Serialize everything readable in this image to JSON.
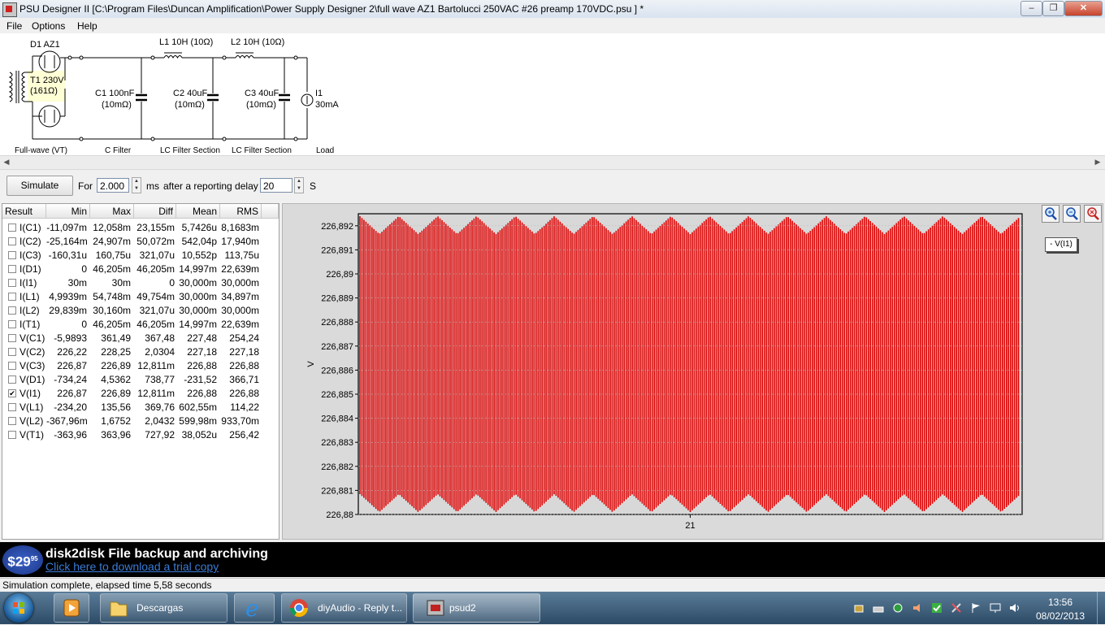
{
  "window": {
    "title": "PSU Designer II  [C:\\Program Files\\Duncan Amplification\\Power Supply Designer 2\\full wave AZ1 Bartolucci 250VAC #26 preamp 170VDC.psu ] *",
    "min": "–",
    "max": "❐",
    "close": "✕"
  },
  "menu": [
    "File",
    "Options",
    "Help"
  ],
  "schematic": {
    "d1": "D1  AZ1",
    "t1_line1": "T1 230V",
    "t1_line2": "(161Ω)",
    "l1": "L1 10H (10Ω)",
    "l2": "L2 10H (10Ω)",
    "c1_line1": "C1 100nF",
    "c1_line2": "(10mΩ)",
    "c2_line1": "C2 40uF",
    "c2_line2": "(10mΩ)",
    "c3_line1": "C3 40uF",
    "c3_line2": "(10mΩ)",
    "i1_line1": "I1",
    "i1_line2": "30mA",
    "sections": [
      "Full-wave (VT)",
      "C Filter",
      "LC Filter Section",
      "LC Filter Section",
      "Load"
    ]
  },
  "sim": {
    "button": "Simulate",
    "for_label": "For",
    "duration": "2.000",
    "ms_label": "ms",
    "delay_label": "after a reporting delay of",
    "delay": "20",
    "s_label": "S"
  },
  "results": {
    "headers": [
      "Result",
      "Min",
      "Max",
      "Diff",
      "Mean",
      "RMS"
    ],
    "rows": [
      {
        "name": "I(C1)",
        "min": "-11,097m",
        "max": "12,058m",
        "diff": "23,155m",
        "mean": "5,7426u",
        "rms": "8,1683m",
        "checked": false
      },
      {
        "name": "I(C2)",
        "min": "-25,164m",
        "max": "24,907m",
        "diff": "50,072m",
        "mean": "542,04p",
        "rms": "17,940m",
        "checked": false
      },
      {
        "name": "I(C3)",
        "min": "-160,31u",
        "max": "160,75u",
        "diff": "321,07u",
        "mean": "10,552p",
        "rms": "113,75u",
        "checked": false
      },
      {
        "name": "I(D1)",
        "min": "0",
        "max": "46,205m",
        "diff": "46,205m",
        "mean": "14,997m",
        "rms": "22,639m",
        "checked": false
      },
      {
        "name": "I(I1)",
        "min": "30m",
        "max": "30m",
        "diff": "0",
        "mean": "30,000m",
        "rms": "30,000m",
        "checked": false
      },
      {
        "name": "I(L1)",
        "min": "4,9939m",
        "max": "54,748m",
        "diff": "49,754m",
        "mean": "30,000m",
        "rms": "34,897m",
        "checked": false
      },
      {
        "name": "I(L2)",
        "min": "29,839m",
        "max": "30,160m",
        "diff": "321,07u",
        "mean": "30,000m",
        "rms": "30,000m",
        "checked": false
      },
      {
        "name": "I(T1)",
        "min": "0",
        "max": "46,205m",
        "diff": "46,205m",
        "mean": "14,997m",
        "rms": "22,639m",
        "checked": false
      },
      {
        "name": "V(C1)",
        "min": "-5,9893",
        "max": "361,49",
        "diff": "367,48",
        "mean": "227,48",
        "rms": "254,24",
        "checked": false
      },
      {
        "name": "V(C2)",
        "min": "226,22",
        "max": "228,25",
        "diff": "2,0304",
        "mean": "227,18",
        "rms": "227,18",
        "checked": false
      },
      {
        "name": "V(C3)",
        "min": "226,87",
        "max": "226,89",
        "diff": "12,811m",
        "mean": "226,88",
        "rms": "226,88",
        "checked": false
      },
      {
        "name": "V(D1)",
        "min": "-734,24",
        "max": "4,5362",
        "diff": "738,77",
        "mean": "-231,52",
        "rms": "366,71",
        "checked": false
      },
      {
        "name": "V(I1)",
        "min": "226,87",
        "max": "226,89",
        "diff": "12,811m",
        "mean": "226,88",
        "rms": "226,88",
        "checked": true
      },
      {
        "name": "V(L1)",
        "min": "-234,20",
        "max": "135,56",
        "diff": "369,76",
        "mean": "602,55m",
        "rms": "114,22",
        "checked": false
      },
      {
        "name": "V(L2)",
        "min": "-367,96m",
        "max": "1,6752",
        "diff": "2,0432",
        "mean": "599,98m",
        "rms": "933,70m",
        "checked": false
      },
      {
        "name": "V(T1)",
        "min": "-363,96",
        "max": "363,96",
        "diff": "727,92",
        "mean": "38,052u",
        "rms": "256,42",
        "checked": false
      }
    ]
  },
  "chart_data": {
    "type": "line",
    "title": "",
    "ylabel": "V",
    "xlabel": "",
    "x_ticks": [
      "21"
    ],
    "y_ticks": [
      "226,892",
      "226,891",
      "226,89",
      "226,889",
      "226,888",
      "226,887",
      "226,886",
      "226,885",
      "226,884",
      "226,883",
      "226,882",
      "226,881",
      "226,88"
    ],
    "ylim": [
      226.88,
      226.8925
    ],
    "legend": "- V(I1)",
    "series": [
      {
        "name": "V(I1)",
        "color": "#e00000",
        "min": 226.87,
        "max": 226.89,
        "mean": 226.88
      }
    ],
    "grid": true
  },
  "chart_ui": {
    "zoom_icons": [
      "zoom-in-icon",
      "zoom-out-icon",
      "zoom-reset-icon"
    ]
  },
  "ad": {
    "price": "$29",
    "cents": "95",
    "title": "disk2disk File backup and archiving",
    "link": "Click here to download a trial copy"
  },
  "status": "Simulation complete, elapsed time 5,58 seconds",
  "taskbar": {
    "items": [
      "Descargas",
      "diyAudio - Reply t...",
      "psud2"
    ],
    "time": "13:56",
    "date": "08/02/2013"
  }
}
